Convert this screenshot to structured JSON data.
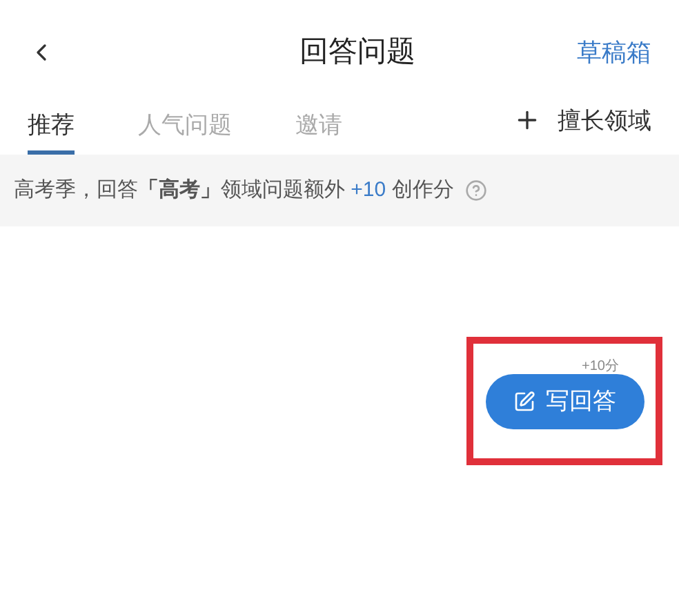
{
  "header": {
    "title": "回答问题",
    "action": "草稿箱"
  },
  "tabs": [
    {
      "label": "推荐",
      "selected": true
    },
    {
      "label": "人气问题",
      "selected": false
    },
    {
      "label": "邀请",
      "selected": false
    }
  ],
  "domain_button": {
    "label": "擅长领域"
  },
  "banner": {
    "prefix": "高考季，回答**「高考」**领域问题额外",
    "bonus": "+10",
    "suffix": "创作分"
  },
  "write_button": {
    "label": "写回答",
    "badge": "+10分",
    "highlighted": true
  }
}
